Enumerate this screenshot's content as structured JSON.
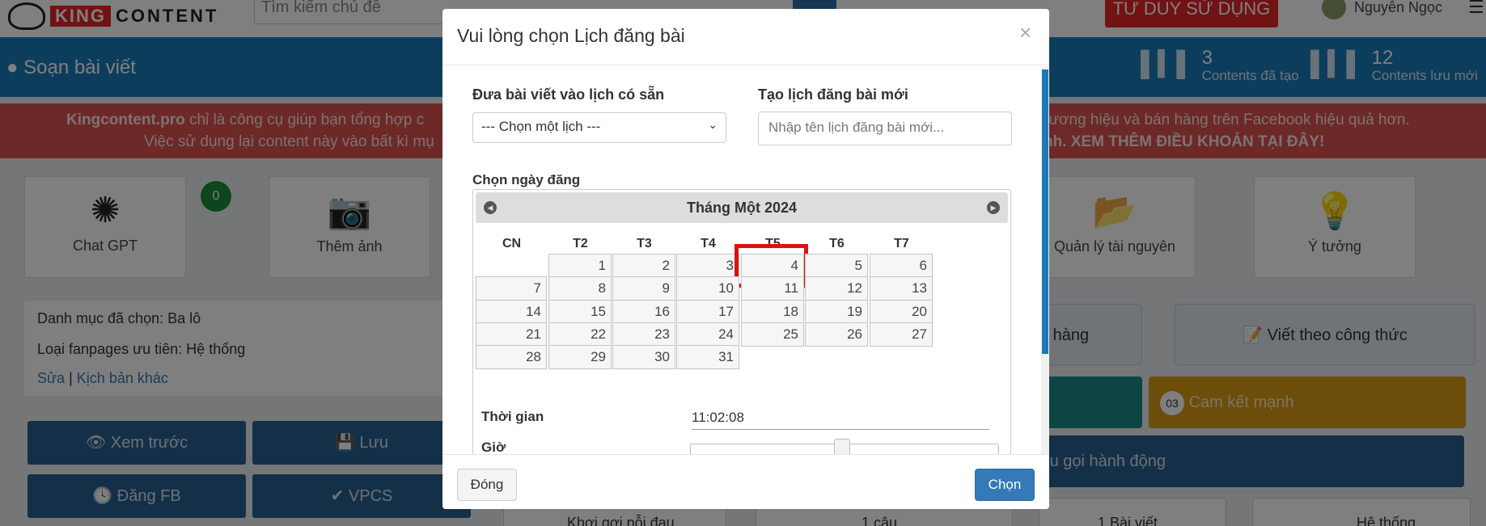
{
  "header": {
    "logo_king": "KING",
    "logo_content": "CONTENT",
    "search_placeholder": "Tìm kiếm chủ đề",
    "cta": "TƯ DUY SỬ DỤNG",
    "user_name": "Nguyễn Ngọc"
  },
  "bluebar": {
    "title": "Soạn bài viết",
    "stats": [
      {
        "num": "3",
        "label": "Contents đã tạo"
      },
      {
        "num": "12",
        "label": "Contents lưu mới"
      }
    ]
  },
  "notice": {
    "left_line1_bold": "Kingcontent.pro",
    "left_line1": " chỉ là công cụ giúp bạn tổng hợp c",
    "left_line2": "Việc sử dụng lại content này vào bất kì mụ",
    "right_line1": "rương hiệu và bán hàng trên Facebook hiệu quả hơn.",
    "right_line2": "nh. XEM THÊM ĐIỀU KHOẢN TẠI ĐÂY!"
  },
  "tools": [
    {
      "label": "Chat GPT",
      "badge": "0"
    },
    {
      "label": "Thêm ảnh"
    },
    {
      "label": "Quản lý tài nguyên"
    },
    {
      "label": "Ý tưởng"
    }
  ],
  "info": {
    "category": "Danh mục đã chọn: Ba lô",
    "fanpage": "Loại fanpages ưu tiên: Hệ thống",
    "edit": "Sửa",
    "sep": "|",
    "other": "Kịch bản khác"
  },
  "actions": {
    "preview": "Xem trước",
    "save": "Lưu",
    "post_fb": "Đăng FB",
    "vpcs": "VPCS"
  },
  "right_panel": {
    "sales": "n hàng",
    "formula": "Viết theo công thức",
    "commit_num": "03",
    "commit": "Cam kết mạnh",
    "cta_call": "iêu gọi hành động",
    "pain": "Khơi gợi nỗi đau",
    "sentence": "1 câu",
    "one_post": "1 Bài viết",
    "system": "Hệ thống"
  },
  "modal": {
    "title": "Vui lòng chọn Lịch đăng bài",
    "close": "×",
    "existing_label": "Đưa bài viết vào lịch có sẵn",
    "existing_select": "--- Chọn một lịch ---",
    "new_label": "Tạo lịch đăng bài mới",
    "new_placeholder": "Nhập tên lịch đăng bài mới...",
    "date_label": "Chọn ngày đăng",
    "month": "Tháng Một 2024",
    "weekdays": [
      "CN",
      "T2",
      "T3",
      "T4",
      "T5",
      "T6",
      "T7"
    ],
    "days": [
      "1",
      "2",
      "3",
      "4",
      "5",
      "6",
      "7",
      "8",
      "9",
      "10",
      "11",
      "12",
      "13",
      "14",
      "15",
      "16",
      "17",
      "18",
      "19",
      "20",
      "21",
      "22",
      "23",
      "24",
      "25",
      "26",
      "27",
      "28",
      "29",
      "30",
      "31"
    ],
    "selected_day": "4",
    "time_label": "Thời gian",
    "time_value": "11:02:08",
    "hour_label": "Giờ",
    "btn_close": "Đóng",
    "btn_choose": "Chọn"
  },
  "colors": {
    "brand_red": "#e32526",
    "brand_blue": "#1a7ab8",
    "highlight": "#e01010"
  }
}
